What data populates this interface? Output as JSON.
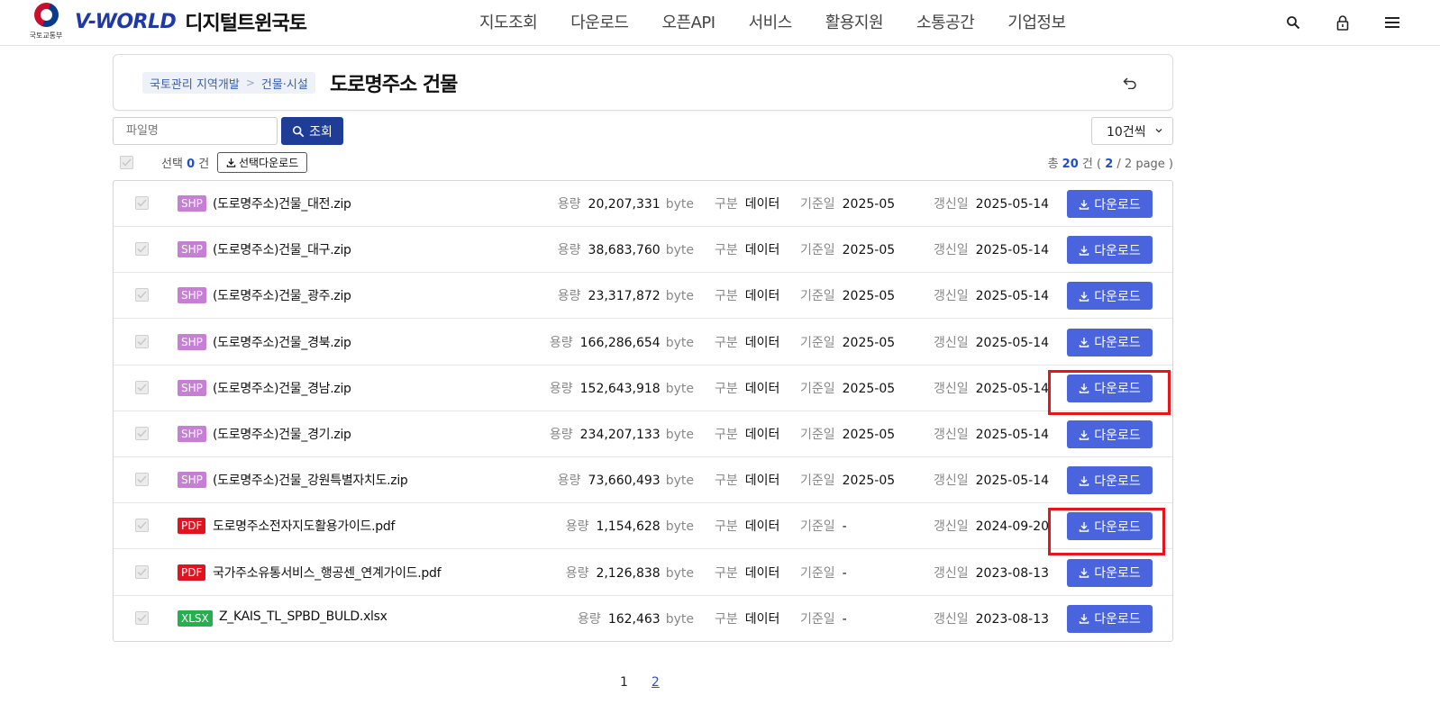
{
  "header": {
    "gov_label": "국토교통부",
    "brand_v": "V-WORLD",
    "brand_kr": "디지털트윈국토",
    "nav": [
      "지도조회",
      "다운로드",
      "오픈API",
      "서비스",
      "활용지원",
      "소통공간",
      "기업정보"
    ],
    "icons": [
      "search-icon",
      "lock-icon",
      "menu-icon"
    ]
  },
  "breadcrumb": {
    "level1": "국토관리 지역개발",
    "level2": "건물·시설"
  },
  "page_title": "도로명주소 건물",
  "search": {
    "placeholder": "파일명",
    "button_label": "조회",
    "per_page": "10건씩"
  },
  "selection": {
    "label_prefix": "선택",
    "count": "0",
    "label_suffix": "건",
    "download_label": "선택다운로드"
  },
  "totals": {
    "prefix": "총",
    "total": "20",
    "unit": "건 (",
    "current_page": "2",
    "sep": "/ 2 page )"
  },
  "labels": {
    "size": "용량",
    "byte": "byte",
    "type": "구분",
    "base_date": "기준일",
    "updated": "갱신일",
    "download": "다운로드"
  },
  "colors": {
    "SHP": "#c77fd6",
    "PDF": "#e0141e",
    "XLSX": "#23b14d",
    "accent": "#4a64dd",
    "search_button": "#1f3d96",
    "highlight": "#e8141c"
  },
  "files": [
    {
      "format": "SHP",
      "name": "(도로명주소)건물_대전.zip",
      "size": "20,207,331",
      "type": "데이터",
      "base": "2025-05",
      "updated": "2025-05-14"
    },
    {
      "format": "SHP",
      "name": "(도로명주소)건물_대구.zip",
      "size": "38,683,760",
      "type": "데이터",
      "base": "2025-05",
      "updated": "2025-05-14"
    },
    {
      "format": "SHP",
      "name": "(도로명주소)건물_광주.zip",
      "size": "23,317,872",
      "type": "데이터",
      "base": "2025-05",
      "updated": "2025-05-14"
    },
    {
      "format": "SHP",
      "name": "(도로명주소)건물_경북.zip",
      "size": "166,286,654",
      "type": "데이터",
      "base": "2025-05",
      "updated": "2025-05-14"
    },
    {
      "format": "SHP",
      "name": "(도로명주소)건물_경남.zip",
      "size": "152,643,918",
      "type": "데이터",
      "base": "2025-05",
      "updated": "2025-05-14"
    },
    {
      "format": "SHP",
      "name": "(도로명주소)건물_경기.zip",
      "size": "234,207,133",
      "type": "데이터",
      "base": "2025-05",
      "updated": "2025-05-14"
    },
    {
      "format": "SHP",
      "name": "(도로명주소)건물_강원특별자치도.zip",
      "size": "73,660,493",
      "type": "데이터",
      "base": "2025-05",
      "updated": "2025-05-14"
    },
    {
      "format": "PDF",
      "name": "도로명주소전자지도활용가이드.pdf",
      "size": "1,154,628",
      "type": "데이터",
      "base": "-",
      "updated": "2024-09-20"
    },
    {
      "format": "PDF",
      "name": "국가주소유통서비스_행공센_연계가이드.pdf",
      "size": "2,126,838",
      "type": "데이터",
      "base": "-",
      "updated": "2023-08-13"
    },
    {
      "format": "XLSX",
      "name": "Z_KAIS_TL_SPBD_BULD.xlsx",
      "size": "162,463",
      "type": "데이터",
      "base": "-",
      "updated": "2023-08-13"
    }
  ],
  "highlighted_rows": [
    4,
    7
  ],
  "pagination": {
    "pages": [
      "1",
      "2"
    ],
    "current": "2"
  }
}
